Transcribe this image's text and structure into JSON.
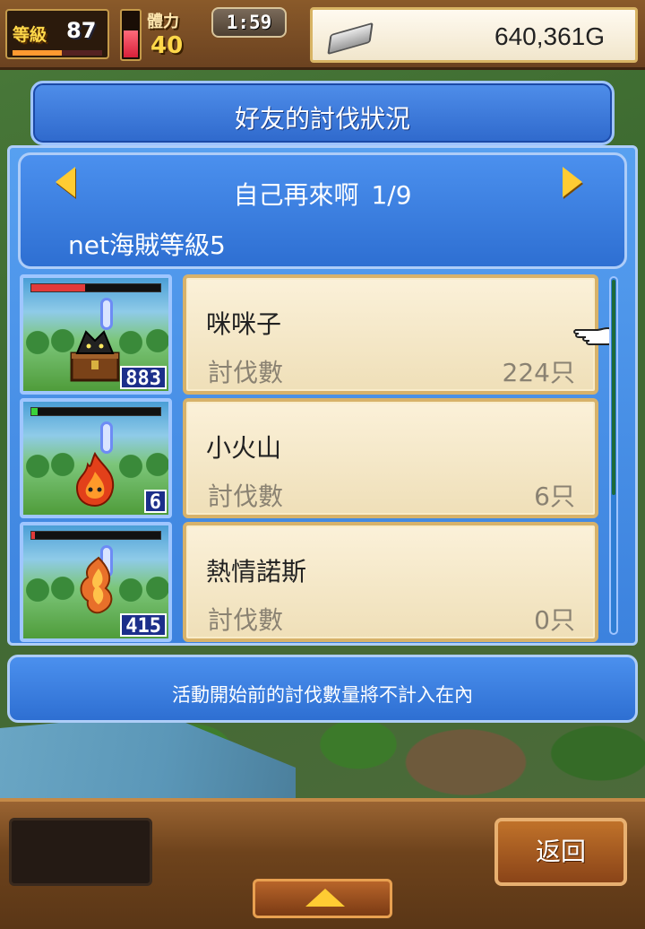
{
  "status_bar": {
    "level_label": "等級",
    "level_value": "87",
    "level_progress": 0.55,
    "stamina_label": "體力",
    "stamina_value": "40",
    "stamina_level": 0.55,
    "timer": "1:59",
    "money": "640,361G",
    "money_icon": "silver-ingot-icon"
  },
  "dialog": {
    "title": "好友的討伐狀況",
    "friend_name": "自己再來啊",
    "page": "1/9",
    "friend_rank": "net海賊等級5",
    "prev_icon": "arrow-left-icon",
    "next_icon": "arrow-right-icon"
  },
  "monsters": [
    {
      "name": "咪咪子",
      "label": "討伐數",
      "count": "224只",
      "level_badge": "883",
      "hp_fraction": 0.42,
      "hp_color": "#e23a3a",
      "icon": "mimic-chest-icon"
    },
    {
      "name": "小火山",
      "label": "討伐數",
      "count": "6只",
      "level_badge": "6",
      "hp_fraction": 0.05,
      "hp_color": "#3ad23a",
      "icon": "fire-spirit-icon"
    },
    {
      "name": "熱情諾斯",
      "label": "討伐數",
      "count": "0只",
      "level_badge": "415",
      "hp_fraction": 0.03,
      "hp_color": "#e23a3a",
      "icon": "flame-serpent-icon"
    }
  ],
  "notice": "活動開始前的討伐數量將不計入在內",
  "bottom": {
    "back_label": "返回",
    "up_icon": "arrow-up-icon"
  }
}
